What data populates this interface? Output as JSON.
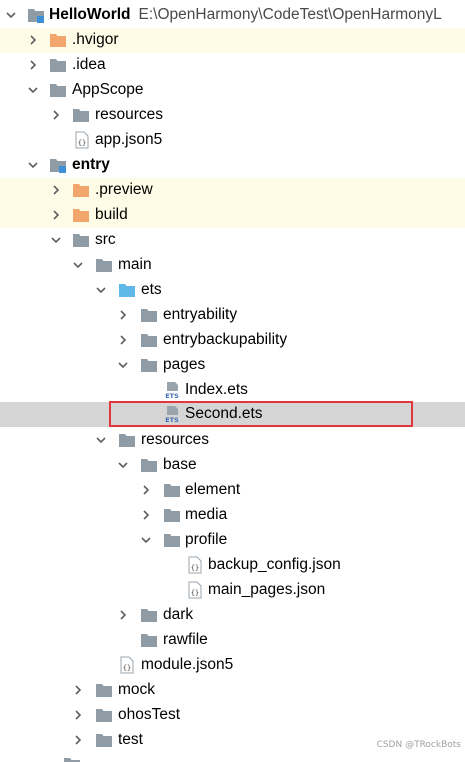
{
  "tree": {
    "root_label": "HelloWorld",
    "root_path": "E:\\OpenHarmony\\CodeTest\\OpenHarmonyL",
    "hvigor": ".hvigor",
    "idea": ".idea",
    "appscope": "AppScope",
    "appscope_resources": "resources",
    "app_json5": "app.json5",
    "entry": "entry",
    "preview": ".preview",
    "build": "build",
    "src": "src",
    "main": "main",
    "ets": "ets",
    "entryability": "entryability",
    "entrybackupability": "entrybackupability",
    "pages": "pages",
    "index_ets": "Index.ets",
    "second_ets": "Second.ets",
    "resources": "resources",
    "base": "base",
    "element": "element",
    "media": "media",
    "profile": "profile",
    "backup_config": "backup_config.json",
    "main_pages": "main_pages.json",
    "dark": "dark",
    "rawfile": "rawfile",
    "module_json5": "module.json5",
    "mock": "mock",
    "ohostest": "ohosTest",
    "test": "test"
  },
  "watermark": "CSDN @TRockBots",
  "colors": {
    "folder_gray": "#8f9ca6",
    "folder_orange": "#f3a66b",
    "folder_blue": "#5fb8e8",
    "selection_border": "#e0383e",
    "selection_fill": "#d5d5d5",
    "excluded_fill": "#fefce6"
  }
}
